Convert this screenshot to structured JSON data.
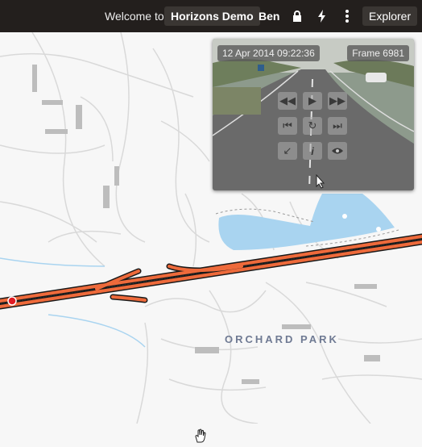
{
  "header": {
    "welcome_text": "Welcome to",
    "project_name": "Horizons Demo",
    "user_name": "Ben",
    "explorer_label": "Explorer",
    "icons": [
      "lock-icon",
      "lightning-icon",
      "kebab-menu-icon"
    ]
  },
  "video": {
    "timestamp": "12 Apr 2014 09:22:36",
    "frame": "Frame 6981",
    "controls": [
      "rewind",
      "play",
      "fast-forward",
      "step-back",
      "rotate",
      "step-forward",
      "back-arrow",
      "info",
      "view"
    ]
  },
  "map": {
    "area_label": "ORCHARD PARK",
    "road_color": "#ee6a3b",
    "water_color": "#a9d4f0"
  }
}
